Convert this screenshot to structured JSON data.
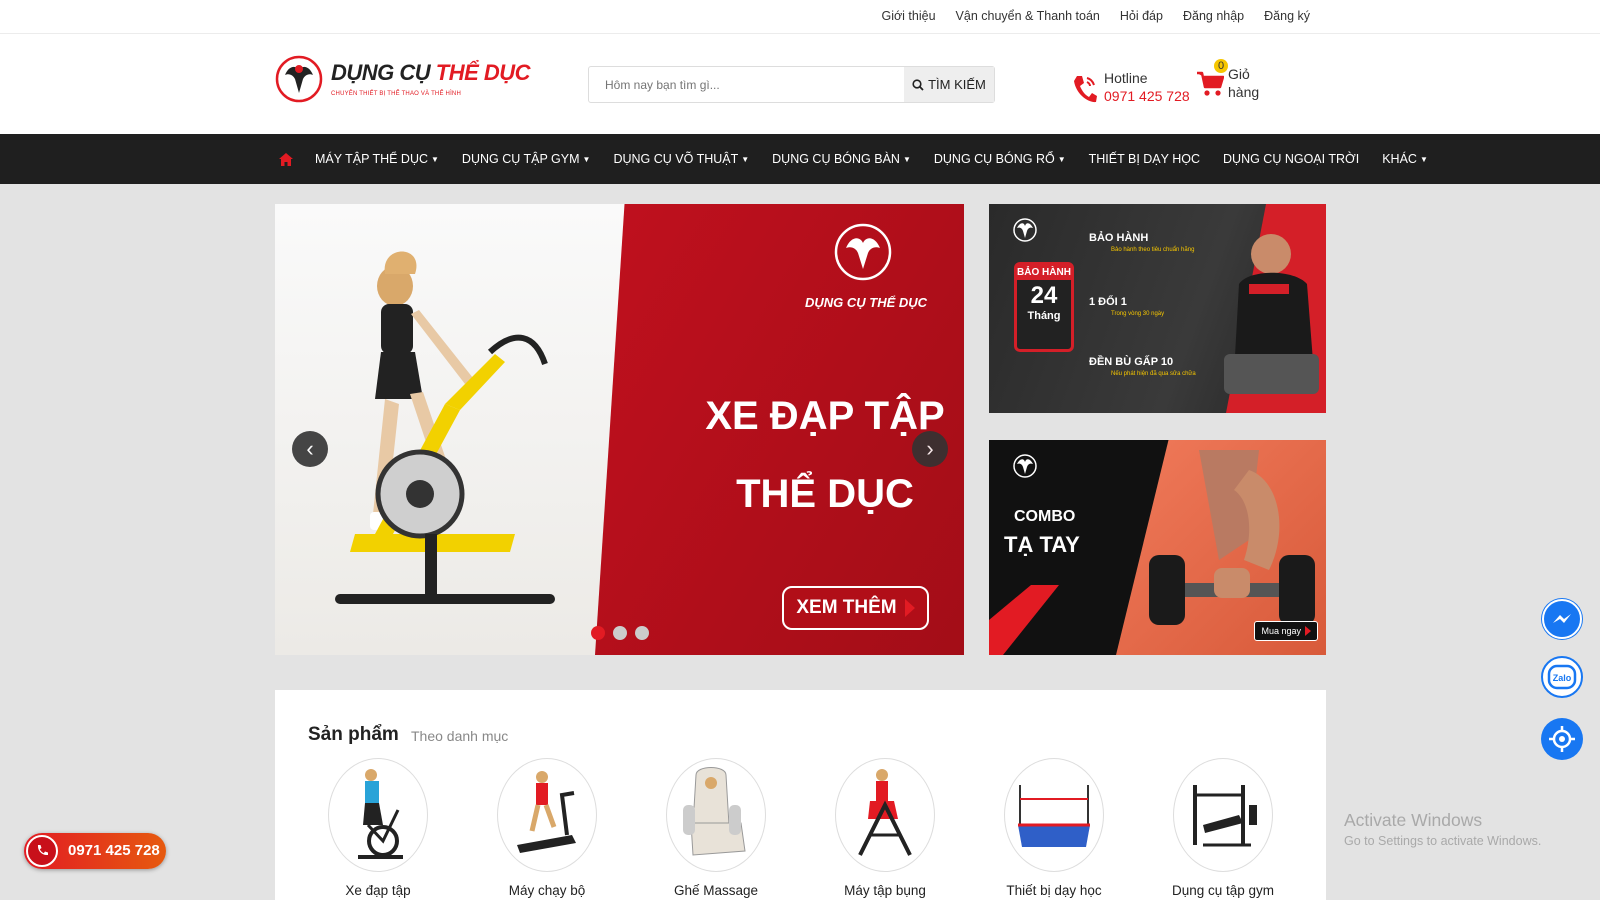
{
  "top_links": [
    "Giới thiệu",
    "Vận chuyển & Thanh toán",
    "Hỏi đáp",
    "Đăng nhập",
    "Đăng ký"
  ],
  "logo": {
    "brand_part1": "DỤNG CỤ",
    "brand_part2": "THỂ DỤC",
    "tagline": "CHUYÊN THIẾT BỊ THỂ THAO VÀ THỂ HÌNH"
  },
  "search": {
    "placeholder": "Hôm nay bạn tìm gì...",
    "button_label": "TÌM KIẾM"
  },
  "hotline": {
    "label": "Hotline",
    "number": "0971 425 728"
  },
  "cart": {
    "count": "0",
    "label": "Giỏ hàng"
  },
  "nav": {
    "items": [
      {
        "label": "MÁY TẬP THỂ DỤC",
        "has_caret": true
      },
      {
        "label": "DỤNG CỤ TẬP GYM",
        "has_caret": true
      },
      {
        "label": "DỤNG CỤ VÕ THUẬT",
        "has_caret": true
      },
      {
        "label": "DỤNG CỤ BÓNG BÀN",
        "has_caret": true
      },
      {
        "label": "DỤNG CỤ BÓNG RỔ",
        "has_caret": true
      },
      {
        "label": "THIẾT BỊ DẠY HỌC",
        "has_caret": false
      },
      {
        "label": "DỤNG CỤ NGOẠI TRỜI",
        "has_caret": false
      },
      {
        "label": "KHÁC",
        "has_caret": true
      }
    ]
  },
  "slider": {
    "brand": "DỤNG CỤ THỂ DỤC",
    "title_line1": "XE ĐẠP TẬP",
    "title_line2": "THỂ DỤC",
    "cta": "XEM THÊM",
    "prev_glyph": "‹",
    "next_glyph": "›",
    "slide_count": 3,
    "active_slide": 1
  },
  "banner_warranty": {
    "badge_title": "BẢO HÀNH",
    "badge_number": "24",
    "badge_unit": "Tháng",
    "line1": "BẢO HÀNH",
    "line1_sub": "Bảo hành theo tiêu chuẩn hãng",
    "line2": "1 ĐỔI 1",
    "line2_sub": "Trong vòng 30 ngày",
    "line3": "ĐỀN BÙ GẤP 10",
    "line3_sub": "Nếu phát hiện đã qua sửa chữa"
  },
  "banner_combo": {
    "line1": "COMBO",
    "line2": "TẠ TAY",
    "buy_label": "Mua ngay"
  },
  "products": {
    "title": "Sản phẩm",
    "subtitle": "Theo danh mục",
    "categories": [
      {
        "name": "Xe đạp tập",
        "icon": "exercise-bike-icon"
      },
      {
        "name": "Máy chạy bộ",
        "icon": "treadmill-icon"
      },
      {
        "name": "Ghế Massage",
        "icon": "massage-chair-icon"
      },
      {
        "name": "Máy tập bụng",
        "icon": "ab-machine-icon"
      },
      {
        "name": "Thiết bị dạy học",
        "icon": "high-jump-mat-icon"
      },
      {
        "name": "Dụng cụ tập gym",
        "icon": "weight-bench-icon"
      }
    ]
  },
  "floating": {
    "call_number": "0971 425 728",
    "zalo_label": "Zalo"
  },
  "activate_windows": {
    "line1": "Activate Windows",
    "line2": "Go to Settings to activate Windows."
  },
  "colors": {
    "brand_red": "#e21b23",
    "nav_bg": "#1f1f1f",
    "page_bg": "#e3e3e3",
    "messenger_blue": "#1877f2"
  }
}
